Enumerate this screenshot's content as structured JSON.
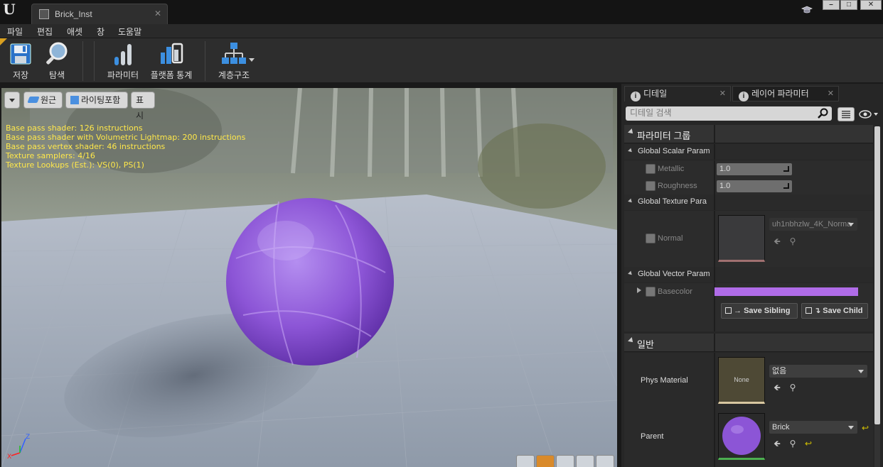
{
  "window": {
    "tab_title": "Brick_Inst",
    "tab_close": "✕",
    "min_glyph": "–",
    "max_glyph": "□",
    "close_glyph": "✕",
    "logo": "U"
  },
  "menu": {
    "items": [
      "파일",
      "편집",
      "애셋",
      "창",
      "도움말"
    ]
  },
  "toolbar": {
    "buttons": [
      {
        "label": "저장",
        "icon": "save-icon"
      },
      {
        "label": "탐색",
        "icon": "browse-magnifier-icon"
      },
      {
        "label": "파라미터",
        "icon": "parameters-icon"
      },
      {
        "label": "플랫폼 통계",
        "icon": "platform-stats-icon"
      },
      {
        "label": "계층구조",
        "icon": "hierarchy-icon"
      }
    ],
    "accent": "#d9a020"
  },
  "viewport": {
    "buttons": {
      "perspective": "원근",
      "lighting": "라이팅포함",
      "show": "표시"
    },
    "stats": [
      "Base pass shader: 126 instructions",
      "Base pass shader with Volumetric Lightmap: 200 instructions",
      "Base pass vertex shader: 46 instructions",
      "Texture samplers: 4/16",
      "Texture Lookups (Est.): VS(0), PS(1)"
    ],
    "stats_color": "#ffe84a",
    "sphere_color": "#8c55d6",
    "axis": {
      "z": "Z",
      "x": "X"
    }
  },
  "details": {
    "tabs": {
      "details": "디테일",
      "layer_params": "레이어 파라미터"
    },
    "search_placeholder": "디테일 검색",
    "sections": {
      "param_groups": "파라미터 그룹",
      "general": "일반"
    },
    "groups": {
      "scalar": "Global Scalar Param",
      "texture": "Global Texture Para",
      "vector": "Global Vector Param"
    },
    "params": {
      "metallic": {
        "label": "Metallic",
        "value": "1.0"
      },
      "roughness": {
        "label": "Roughness",
        "value": "1.0"
      },
      "normal": {
        "label": "Normal",
        "texture": "uh1nbhzlw_4K_Norma"
      },
      "basecolor": {
        "label": "Basecolor",
        "color": "#b06ce8"
      }
    },
    "buttons": {
      "save_sibling": "Save Sibling",
      "save_child": "Save Child"
    },
    "general": {
      "phys_material": {
        "label": "Phys Material",
        "thumb_text": "None",
        "value": "없음"
      },
      "parent": {
        "label": "Parent",
        "value": "Brick"
      }
    }
  }
}
